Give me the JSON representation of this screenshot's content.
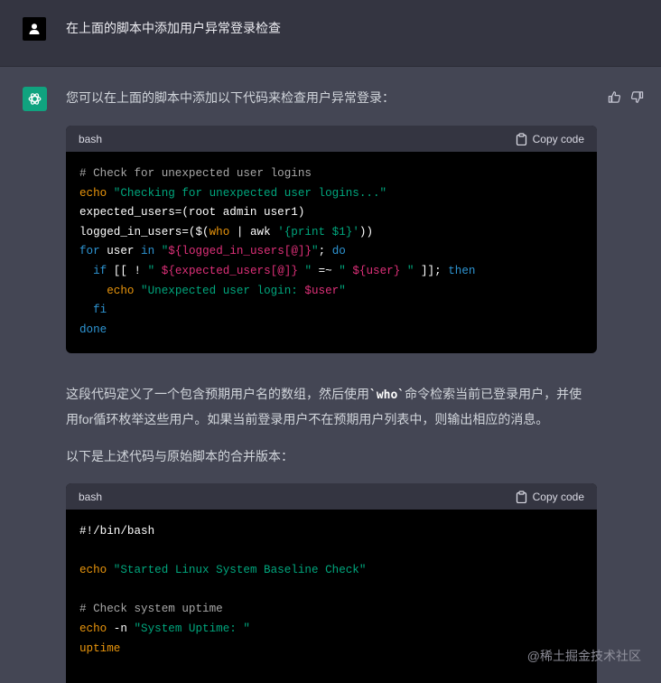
{
  "user_message": {
    "text": "在上面的脚本中添加用户异常登录检查"
  },
  "assistant": {
    "intro": "您可以在上面的脚本中添加以下代码来检查用户异常登录：",
    "code_block_1": {
      "language": "bash",
      "copy_label": "Copy code",
      "lines": [
        [
          [
            "c-comment",
            "# Check for unexpected user logins"
          ]
        ],
        [
          [
            "c-builtin",
            "echo"
          ],
          [
            "c-plain",
            " "
          ],
          [
            "c-str",
            "\"Checking for unexpected user logins...\""
          ]
        ],
        [
          [
            "c-plain",
            "expected_users=(root admin user1)"
          ]
        ],
        [
          [
            "c-plain",
            "logged_in_users=($("
          ],
          [
            "c-builtin",
            "who"
          ],
          [
            "c-plain",
            " | awk "
          ],
          [
            "c-str",
            "'{print $1}'"
          ],
          [
            "c-plain",
            "))"
          ]
        ],
        [
          [
            "c-kw",
            "for"
          ],
          [
            "c-plain",
            " user "
          ],
          [
            "c-kw",
            "in"
          ],
          [
            "c-plain",
            " "
          ],
          [
            "c-str",
            "\""
          ],
          [
            "c-var",
            "${logged_in_users[@]}"
          ],
          [
            "c-str",
            "\""
          ],
          [
            "c-plain",
            "; "
          ],
          [
            "c-kw",
            "do"
          ]
        ],
        [
          [
            "c-plain",
            "  "
          ],
          [
            "c-kw",
            "if"
          ],
          [
            "c-plain",
            " [[ ! "
          ],
          [
            "c-str",
            "\" "
          ],
          [
            "c-var",
            "${expected_users[@]}"
          ],
          [
            "c-str",
            " \""
          ],
          [
            "c-plain",
            " =~ "
          ],
          [
            "c-str",
            "\" "
          ],
          [
            "c-var",
            "${user}"
          ],
          [
            "c-str",
            " \""
          ],
          [
            "c-plain",
            " ]]; "
          ],
          [
            "c-kw",
            "then"
          ]
        ],
        [
          [
            "c-plain",
            "    "
          ],
          [
            "c-builtin",
            "echo"
          ],
          [
            "c-plain",
            " "
          ],
          [
            "c-str",
            "\"Unexpected user login: "
          ],
          [
            "c-var",
            "$user"
          ],
          [
            "c-str",
            "\""
          ]
        ],
        [
          [
            "c-plain",
            "  "
          ],
          [
            "c-kw",
            "fi"
          ]
        ],
        [
          [
            "c-kw",
            "done"
          ]
        ]
      ]
    },
    "explanation_line1_a": "这段代码定义了一个包含预期用户名的数组，然后使用",
    "explanation_code": "`who`",
    "explanation_line1_b": "命令检索当前已登录用户，并使",
    "explanation_line2": "用for循环枚举这些用户。如果当前登录用户不在预期用户列表中，则输出相应的消息。",
    "merge_intro": "以下是上述代码与原始脚本的合并版本：",
    "code_block_2": {
      "language": "bash",
      "copy_label": "Copy code",
      "lines": [
        [
          [
            "c-plain",
            "#!/bin/bash"
          ]
        ],
        [
          [
            "c-plain",
            ""
          ]
        ],
        [
          [
            "c-builtin",
            "echo"
          ],
          [
            "c-plain",
            " "
          ],
          [
            "c-str",
            "\"Started Linux System Baseline Check\""
          ]
        ],
        [
          [
            "c-plain",
            ""
          ]
        ],
        [
          [
            "c-comment",
            "# Check system uptime"
          ]
        ],
        [
          [
            "c-builtin",
            "echo"
          ],
          [
            "c-plain",
            " -n "
          ],
          [
            "c-str",
            "\"System Uptime: \""
          ]
        ],
        [
          [
            "c-builtin",
            "uptime"
          ]
        ]
      ]
    }
  },
  "watermark": "@稀土掘金技术社区",
  "colors": {
    "page_bg": "#444654",
    "user_bg": "#343541",
    "bot_accent": "#10a37f",
    "code_bg": "#000000"
  }
}
